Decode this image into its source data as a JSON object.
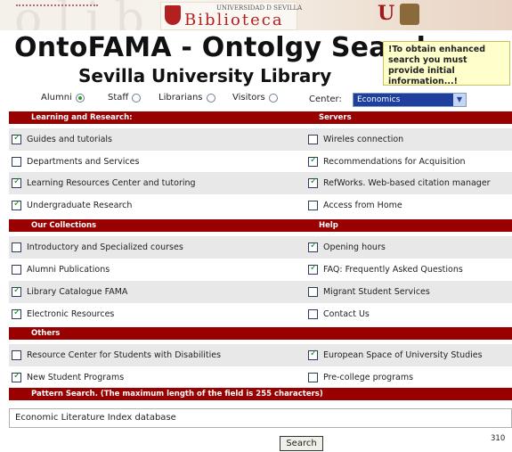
{
  "banner": {
    "ghost_text": "olib  ca",
    "univ_label": "UNIVERSIDAD D SEVILLA",
    "library_label": "Biblioteca",
    "us_label": "U"
  },
  "title": "OntoFAMA - Ontolgy Search",
  "subtitle": "Sevilla University Library",
  "notice": "!To obtain enhanced search you must provide initial information...!",
  "filters": {
    "profiles": [
      {
        "label": "Alumni",
        "selected": true
      },
      {
        "label": "Staff",
        "selected": false
      },
      {
        "label": "Librarians",
        "selected": false
      },
      {
        "label": "Visitors",
        "selected": false
      }
    ],
    "center_label": "Center:",
    "center_value": "Economics"
  },
  "sections": [
    {
      "left_title": "Learning and Research:",
      "right_title": "Servers",
      "rows": [
        {
          "left": {
            "label": "Guides and tutorials",
            "checked": true
          },
          "right": {
            "label": "Wireles connection",
            "checked": false
          }
        },
        {
          "left": {
            "label": "Departments and Services",
            "checked": false
          },
          "right": {
            "label": "Recommendations for Acquisition",
            "checked": true
          }
        },
        {
          "left": {
            "label": "Learning Resources Center and tutoring",
            "checked": true
          },
          "right": {
            "label": "RefWorks. Web-based citation manager",
            "checked": true
          }
        },
        {
          "left": {
            "label": "Undergraduate Research",
            "checked": true
          },
          "right": {
            "label": "Access from Home",
            "checked": false
          }
        }
      ]
    },
    {
      "left_title": "Our Collections",
      "right_title": "Help",
      "rows": [
        {
          "left": {
            "label": "Introductory and Specialized courses",
            "checked": false
          },
          "right": {
            "label": "Opening hours",
            "checked": true
          }
        },
        {
          "left": {
            "label": "Alumni Publications",
            "checked": false
          },
          "right": {
            "label": "FAQ: Frequently Asked Questions",
            "checked": true
          }
        },
        {
          "left": {
            "label": "Library Catalogue FAMA",
            "checked": true
          },
          "right": {
            "label": "Migrant Student Services",
            "checked": false
          }
        },
        {
          "left": {
            "label": "Electronic Resources",
            "checked": true
          },
          "right": {
            "label": "Contact Us",
            "checked": false
          }
        }
      ]
    },
    {
      "left_title": "Others",
      "right_title": "",
      "rows": [
        {
          "left": {
            "label": "Resource Center for Students with Disabilities",
            "checked": false
          },
          "right": {
            "label": "European Space of University Studies",
            "checked": true
          }
        },
        {
          "left": {
            "label": "New Student Programs",
            "checked": true
          },
          "right": {
            "label": "Pre-college programs",
            "checked": false
          }
        }
      ]
    }
  ],
  "pattern": {
    "title": "Pattern Search. (The maximum length of the field is 255 characters)",
    "value": "Economic Literature Index database"
  },
  "search_label": "Search",
  "char_count": "310",
  "colors": {
    "header_bg": "#990000",
    "row_shade": "#e8e8e8",
    "notice_bg": "#ffffcc"
  }
}
